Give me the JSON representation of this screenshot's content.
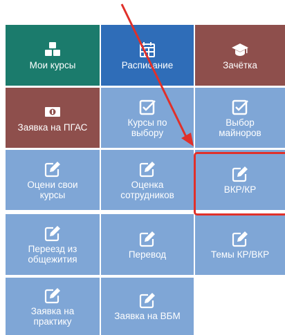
{
  "colors": {
    "teal": "#1b7b6c",
    "blue": "#2f6db8",
    "maroon": "#8e4f4c",
    "light_blue": "#7fa6d6",
    "annotation_red": "#e0302a"
  },
  "tiles": [
    {
      "label": "Мои курсы",
      "icon": "cubes-icon",
      "color": "teal"
    },
    {
      "label": "Расписание",
      "icon": "calendar-icon",
      "color": "blue"
    },
    {
      "label": "Зачётка",
      "icon": "graduation-cap-icon",
      "color": "maroon"
    },
    {
      "label": "Заявка на ПГАС",
      "icon": "money-icon",
      "color": "maroon"
    },
    {
      "label": "Курсы по\nвыбору",
      "icon": "checkbox-icon",
      "color": "light_blue"
    },
    {
      "label": "Выбор\nмайноров",
      "icon": "checkbox-icon",
      "color": "light_blue"
    },
    {
      "label": "Оцени свои\nкурсы",
      "icon": "edit-icon",
      "color": "light_blue"
    },
    {
      "label": "Оценка\nсотрудников",
      "icon": "edit-icon",
      "color": "light_blue"
    },
    {
      "label": "ВКР/КР",
      "icon": "edit-icon",
      "color": "light_blue"
    },
    {
      "label": "Переезд из\nобщежития",
      "icon": "edit-icon",
      "color": "light_blue"
    },
    {
      "label": "Перевод",
      "icon": "edit-icon",
      "color": "light_blue"
    },
    {
      "label": "Темы КР/ВКР",
      "icon": "edit-icon",
      "color": "light_blue"
    },
    {
      "label": "Заявка на\nпрактику",
      "icon": "edit-icon",
      "color": "light_blue"
    },
    {
      "label": "Заявка на ВБМ",
      "icon": "edit-icon",
      "color": "light_blue"
    }
  ]
}
